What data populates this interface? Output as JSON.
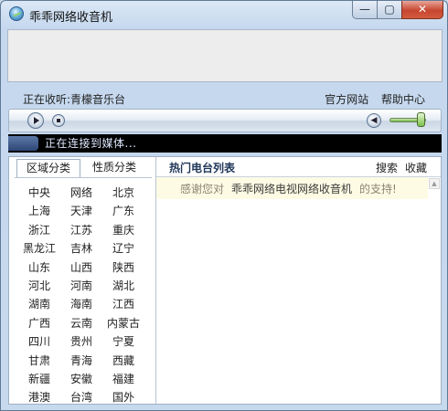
{
  "window": {
    "title": "乖乖网络收音机",
    "minimize": "—",
    "maximize": "▢",
    "close": "✕"
  },
  "status": {
    "now_playing": "正在收听:青檬音乐台",
    "links": [
      "官方网站",
      "帮助中心"
    ]
  },
  "player": {
    "info_text": "正在连接到媒体...",
    "speaker_glyph": "◀",
    "volume_level": 0.85
  },
  "left": {
    "tabs": [
      "区域分类",
      "性质分类"
    ],
    "regions": [
      [
        "中央",
        "网络",
        "北京"
      ],
      [
        "上海",
        "天津",
        "广东"
      ],
      [
        "浙江",
        "江苏",
        "重庆"
      ],
      [
        "黑龙江",
        "吉林",
        "辽宁"
      ],
      [
        "山东",
        "山西",
        "陕西"
      ],
      [
        "河北",
        "河南",
        "湖北"
      ],
      [
        "湖南",
        "海南",
        "江西"
      ],
      [
        "广西",
        "云南",
        "内蒙古"
      ],
      [
        "四川",
        "贵州",
        "宁夏"
      ],
      [
        "甘肃",
        "青海",
        "西藏"
      ],
      [
        "新疆",
        "安徽",
        "福建"
      ],
      [
        "港澳",
        "台湾",
        "国外"
      ]
    ]
  },
  "right": {
    "title": "热门电台列表",
    "search": "搜索",
    "favorites": "收藏",
    "thanks_prefix": "感谢您对",
    "thanks_name": "乖乖网络电视网络收音机",
    "thanks_suffix": "的支持!",
    "scroll_up": "▲"
  }
}
